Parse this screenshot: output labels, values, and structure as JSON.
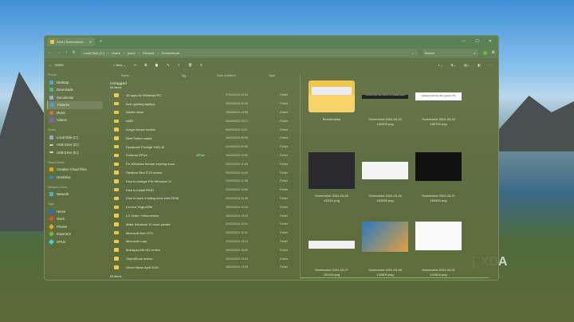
{
  "window": {
    "tab_title": "XDA | Screenshots"
  },
  "address": {
    "crumbs": [
      "Local Disk (C:)",
      "Users",
      "joaoc",
      "Pictures",
      "Screenshots"
    ],
    "search_placeholder": "Search"
  },
  "toolbar": {
    "new_label": "New"
  },
  "sidebar": {
    "home": "Home",
    "pinned_label": "Pinned",
    "pinned": [
      "Desktop",
      "Downloads",
      "Documents",
      "Pictures",
      "Music",
      "Videos"
    ],
    "drives_label": "Drives",
    "drives": [
      "Local Disk (C:)",
      "USB Drive (D:)",
      "USB Drive (E:)"
    ],
    "cloud_label": "Cloud Drives",
    "cloud": [
      "Creative Cloud Files",
      "OneDrive"
    ],
    "network_label": "Network Drives",
    "network": [
      "Network"
    ],
    "tags_label": "Tags",
    "tags": [
      {
        "name": "Home",
        "color": "#1e6fd9"
      },
      {
        "name": "Work",
        "color": "#e0502a"
      },
      {
        "name": "Photos",
        "color": "#e8a020"
      },
      {
        "name": "Important",
        "color": "#7cb342"
      },
      {
        "name": "GPUs",
        "color": "#3fd0e0"
      }
    ]
  },
  "list": {
    "headers": {
      "name": "Name",
      "tag": "Tag",
      "date": "Date modified",
      "type": "Type"
    },
    "group": "Untagged",
    "count": "54 items",
    "rows": [
      {
        "name": "10 apps for Windows PC",
        "tag": "",
        "date": "17/04/2024 12:24",
        "type": "Folder"
      },
      {
        "name": "Acer gaming laptops",
        "tag": "",
        "date": "09/04/2024 11:43",
        "type": "Folder"
      },
      {
        "name": "Adobe news",
        "tag": "",
        "date": "15/04/2024 14:55",
        "type": "Folder"
      },
      {
        "name": "AMD",
        "tag": "",
        "date": "16/04/2024 15:21",
        "type": "Folder"
      },
      {
        "name": "Aurga Viewer review",
        "tag": "",
        "date": "04/04/2024 12:07",
        "type": "Folder"
      },
      {
        "name": "Best Switch cases",
        "tag": "",
        "date": "16/04/2024 09:26",
        "type": "Folder"
      },
      {
        "name": "Dynabook Portégé X40L-M",
        "tag": "",
        "date": "24/04/2024 09:50",
        "type": "Folder"
      },
      {
        "name": "External GPUs",
        "tag": "GPUs",
        "date": "18/04/2024 12:52",
        "type": "Folder"
      },
      {
        "name": "Fix Windows license expiring soon",
        "tag": "",
        "date": "25/03/2024 11:26",
        "type": "Folder"
      },
      {
        "name": "Geekom Mini IT13 review",
        "tag": "",
        "date": "29/03/2024 13:40",
        "type": "Folder"
      },
      {
        "name": "How to change PIN Windows 11",
        "tag": "",
        "date": "23/04/2024 11:38",
        "type": "Folder"
      },
      {
        "name": "How to install RSAT",
        "tag": "",
        "date": "22/03/2024 10:56",
        "type": "Folder"
      },
      {
        "name": "How to save a failing drive with DISM",
        "tag": "",
        "date": "23/04/2024 15:49",
        "type": "Folder"
      },
      {
        "name": "Lenovo Yoga ARM",
        "tag": "",
        "date": "18/04/2024 12:26",
        "type": "Folder"
      },
      {
        "name": "LG Gram +View review",
        "tag": "",
        "date": "16/04/2024 13:25",
        "type": "Folder"
      },
      {
        "name": "Make Windows 11 more private",
        "tag": "",
        "date": "22/03/2024 12:04",
        "type": "Folder"
      },
      {
        "name": "Microsoft Bob OTD",
        "tag": "",
        "date": "29/03/2024 11:01",
        "type": "Folder"
      },
      {
        "name": "Microsoft Loop",
        "tag": "",
        "date": "22/04/2024 15:14",
        "type": "Folder"
      },
      {
        "name": "Mobapad M6 HD review",
        "tag": "",
        "date": "26/03/2024 16:05",
        "type": "Folder"
      },
      {
        "name": "ObjectDock review",
        "tag": "",
        "date": "02/04/2024 13:03",
        "type": "Folder"
      },
      {
        "name": "Omen News April 2024",
        "tag": "",
        "date": "18/04/2024 13:30",
        "type": "Folder"
      }
    ]
  },
  "status": "53 items",
  "preview": [
    {
      "l1": "Benchmarks",
      "l2": ""
    },
    {
      "l1": "Screenshot 2024-03-22",
      "l2": "182503.png"
    },
    {
      "l1": "Screenshot 2024-03-22",
      "l2": "182724.png"
    },
    {
      "l1": "Screenshot 2024-03-25",
      "l2": "111110.png"
    },
    {
      "l1": "Screenshot 2024-03-26",
      "l2": "162059.png"
    },
    {
      "l1": "Screenshot 2024-03-27",
      "l2": "150843.png"
    },
    {
      "l1": "Screenshot 2024-03-27",
      "l2": "151115.png"
    },
    {
      "l1": "Screenshot 2024-03-28",
      "l2": "132609.png"
    },
    {
      "l1": "Screenshot 2024-04-01",
      "l2": "122804.png"
    }
  ],
  "thumb_texts": {
    "t1": "I sent these Fujer Tools I need to run a Windows System",
    "t2": "natively built into the system OS"
  },
  "watermark": "XDA"
}
